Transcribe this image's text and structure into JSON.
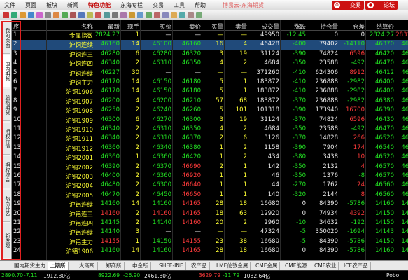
{
  "menubar": {
    "items": [
      "文件",
      "页面",
      "板块",
      "新闻",
      "特色功能",
      "东海专栏",
      "交易",
      "工具",
      "帮助"
    ],
    "active_index": 4,
    "title": "博易云-东海期货",
    "trade_label": "交易",
    "forum_label": "论坛"
  },
  "sidebar": {
    "tabs": [
      "我的页面",
      "国内期货",
      "股指期货",
      "期权行情",
      "期权综合",
      "热点排名",
      "新发现"
    ],
    "active_index": 1
  },
  "grid": {
    "headers": [
      "序",
      "名称",
      "最新",
      "现手",
      "买价",
      "卖价",
      "买量",
      "卖量",
      "成交量",
      "涨跌",
      "持仓量",
      "仓差",
      "结算价",
      "开"
    ],
    "rows": [
      {
        "seq": "1",
        "name": "金属指数",
        "last": "2824.27",
        "cur": "1",
        "bid": "—",
        "ask": "—",
        "bv": "—",
        "av": "—",
        "vol": "49950",
        "chg": "-12.45",
        "oi": "0",
        "oid": "0",
        "settle": "2824.27",
        "open": "2831.3"
      },
      {
        "seq": "2",
        "name": "沪铜连续",
        "last": "46160",
        "cur": "14",
        "bid": "46100",
        "ask": "46160",
        "bv": "16",
        "av": "4",
        "vol": "46428",
        "chg": "-400",
        "oi": "79402",
        "oid": "-14110",
        "settle": "46370",
        "open": "4651"
      },
      {
        "seq": "3",
        "name": "沪铜连三",
        "last": "46280",
        "cur": "6",
        "bid": "46280",
        "ask": "46320",
        "bv": "3",
        "av": "19",
        "vol": "31124",
        "chg": "-390",
        "oi": "74824",
        "oid": "6596",
        "settle": "46420",
        "open": "4660"
      },
      {
        "seq": "4",
        "name": "沪铜连四",
        "last": "46340",
        "cur": "2",
        "bid": "46310",
        "ask": "46350",
        "bv": "4",
        "av": "2",
        "vol": "4684",
        "chg": "-350",
        "oi": "23588",
        "oid": "-492",
        "settle": "46470",
        "open": "4659"
      },
      {
        "seq": "5",
        "name": "沪铜连续",
        "last": "46227",
        "cur": "30",
        "bid": "—",
        "ask": "—",
        "bv": "—",
        "av": "—",
        "vol": "371260",
        "chg": "-410",
        "oi": "624306",
        "oid": "8912",
        "settle": "46412",
        "open": "4659"
      },
      {
        "seq": "6",
        "name": "沪铜主力",
        "last": "46170",
        "cur": "14",
        "bid": "46150",
        "ask": "46180",
        "bv": "5",
        "av": "1",
        "vol": "183872",
        "chg": "-410",
        "oi": "236888",
        "oid": "-2982",
        "settle": "46400",
        "open": "4658"
      },
      {
        "seq": "7",
        "name": "沪铜1906",
        "last": "46170",
        "cur": "14",
        "bid": "46150",
        "ask": "46180",
        "bv": "5",
        "av": "1",
        "vol": "183872",
        "chg": "-410",
        "oi": "236888",
        "oid": "-2982",
        "settle": "46400",
        "open": "4658"
      },
      {
        "seq": "8",
        "name": "沪铜1907",
        "last": "46200",
        "cur": "4",
        "bid": "46200",
        "ask": "46210",
        "bv": "57",
        "av": "68",
        "vol": "183872",
        "chg": "-370",
        "oi": "236888",
        "oid": "-2982",
        "settle": "46380",
        "open": "4657"
      },
      {
        "seq": "9",
        "name": "沪铜1908",
        "last": "46250",
        "cur": "2",
        "bid": "46240",
        "ask": "46260",
        "bv": "5",
        "av": "101",
        "vol": "101318",
        "chg": "-390",
        "oi": "173940",
        "oid": "16700",
        "settle": "46390",
        "open": "4659"
      },
      {
        "seq": "10",
        "name": "沪铜1909",
        "last": "46300",
        "cur": "6",
        "bid": "46270",
        "ask": "46300",
        "bv": "3",
        "av": "19",
        "vol": "31124",
        "chg": "-370",
        "oi": "74824",
        "oid": "6596",
        "settle": "46430",
        "open": "4660"
      },
      {
        "seq": "11",
        "name": "沪铜1910",
        "last": "46340",
        "cur": "2",
        "bid": "46310",
        "ask": "46350",
        "bv": "4",
        "av": "2",
        "vol": "4684",
        "chg": "-350",
        "oi": "23588",
        "oid": "-492",
        "settle": "46470",
        "open": "4660"
      },
      {
        "seq": "12",
        "name": "沪铜1911",
        "last": "46340",
        "cur": "2",
        "bid": "46310",
        "ask": "46370",
        "bv": "2",
        "av": "6",
        "vol": "3126",
        "chg": "-370",
        "oi": "14828",
        "oid": "266",
        "settle": "46520",
        "open": "4660"
      },
      {
        "seq": "13",
        "name": "沪铜1912",
        "last": "46360",
        "cur": "2",
        "bid": "46340",
        "ask": "46380",
        "bv": "1",
        "av": "2",
        "vol": "1158",
        "chg": "-390",
        "oi": "7904",
        "oid": "174",
        "settle": "46540",
        "open": "4663"
      },
      {
        "seq": "14",
        "name": "沪铜2001",
        "last": "46360",
        "cur": "1",
        "bid": "46360",
        "ask": "46420",
        "bv": "1",
        "av": "2",
        "vol": "434",
        "chg": "-380",
        "oi": "3438",
        "oid": "10",
        "settle": "46520",
        "open": "4663"
      },
      {
        "seq": "15",
        "name": "沪铜2002",
        "last": "46390",
        "cur": "2",
        "bid": "46370",
        "ask": "46690",
        "bv": "2",
        "av": "1",
        "vol": "142",
        "chg": "-350",
        "oi": "2132",
        "oid": "4",
        "settle": "46570",
        "open": "4663"
      },
      {
        "seq": "16",
        "name": "沪铜2003",
        "last": "46400",
        "cur": "2",
        "bid": "46360",
        "ask": "46920",
        "bv": "1",
        "av": "1",
        "vol": "46",
        "chg": "-350",
        "oi": "1376",
        "oid": "-8",
        "settle": "46570",
        "open": "4667"
      },
      {
        "seq": "17",
        "name": "沪铜2004",
        "last": "46480",
        "cur": "2",
        "bid": "46300",
        "ask": "46640",
        "bv": "1",
        "av": "1",
        "vol": "44",
        "chg": "-270",
        "oi": "1762",
        "oid": "24",
        "settle": "46560",
        "open": "4666"
      },
      {
        "seq": "18",
        "name": "沪铜2005",
        "last": "46470",
        "cur": "2",
        "bid": "46450",
        "ask": "46650",
        "bv": "1",
        "av": "1",
        "vol": "140",
        "chg": "-320",
        "oi": "2144",
        "oid": "8",
        "settle": "46560",
        "open": "4661"
      },
      {
        "seq": "19",
        "name": "沪铝连续",
        "last": "14160",
        "cur": "14",
        "bid": "14160",
        "ask": "14165",
        "bv": "28",
        "av": "18",
        "vol": "16680",
        "chg": "0",
        "oi": "84390",
        "oid": "-5786",
        "settle": "14160",
        "open": "1413"
      },
      {
        "seq": "20",
        "name": "沪铝连三",
        "last": "14160",
        "cur": "2",
        "bid": "14160",
        "ask": "14165",
        "bv": "18",
        "av": "63",
        "vol": "12920",
        "chg": "0",
        "oi": "74934",
        "oid": "4392",
        "settle": "14150",
        "open": "1413"
      },
      {
        "seq": "21",
        "name": "沪铝连四",
        "last": "14145",
        "cur": "2",
        "bid": "14140",
        "ask": "14160",
        "bv": "20",
        "av": "2",
        "vol": "2960",
        "chg": "-10",
        "oi": "34632",
        "oid": "-192",
        "settle": "14150",
        "open": "1414"
      },
      {
        "seq": "22",
        "name": "沪铝连续",
        "last": "14140",
        "cur": "3",
        "bid": "—",
        "ask": "—",
        "bv": "—",
        "av": "—",
        "vol": "47324",
        "chg": "-5",
        "oi": "350020",
        "oid": "-1694",
        "settle": "14143",
        "open": "1413"
      },
      {
        "seq": "23",
        "name": "沪铝主力",
        "last": "14155",
        "cur": "1",
        "bid": "14150",
        "ask": "14155",
        "bv": "23",
        "av": "38",
        "vol": "16680",
        "chg": "-5",
        "oi": "84390",
        "oid": "-5786",
        "settle": "14150",
        "open": "1413"
      },
      {
        "seq": "24",
        "name": "沪铝1906",
        "last": "14160",
        "cur": "14",
        "bid": "14160",
        "ask": "14165",
        "bv": "28",
        "av": "18",
        "vol": "16680",
        "chg": "0",
        "oi": "84390",
        "oid": "-5786",
        "settle": "14160",
        "open": "1413"
      }
    ]
  },
  "tabs": {
    "items": [
      "国内期货主力",
      "上期所",
      "大商所",
      "郑商所",
      "中金所",
      "SHFE-INE",
      "农产品",
      "LME伦敦金属",
      "CME金属",
      "CME能源",
      "CME农业",
      "ICE农产品"
    ],
    "active_index": 1
  },
  "status": {
    "items": [
      {
        "text": "2890.70",
        "color": "#22e022"
      },
      {
        "text": "-7.11",
        "color": "#22e022"
      },
      {
        "text": "1912.80亿",
        "color": "#e8e8e8"
      },
      {
        "text": "8922.69",
        "color": "#22e022"
      },
      {
        "text": "-26.90",
        "color": "#22e022"
      },
      {
        "text": "2461.80亿",
        "color": "#e8e8e8"
      },
      {
        "text": "3629.79",
        "color": "#ff3b3b"
      },
      {
        "text": "-11.79",
        "color": "#22e022"
      },
      {
        "text": "1082.64亿",
        "color": "#e8e8e8"
      }
    ],
    "brand": "Pobo"
  },
  "colors": {
    "up": "#ff3b3b",
    "down": "#22e022",
    "name": "#ffff33",
    "neutral": "#e8e8e8"
  }
}
